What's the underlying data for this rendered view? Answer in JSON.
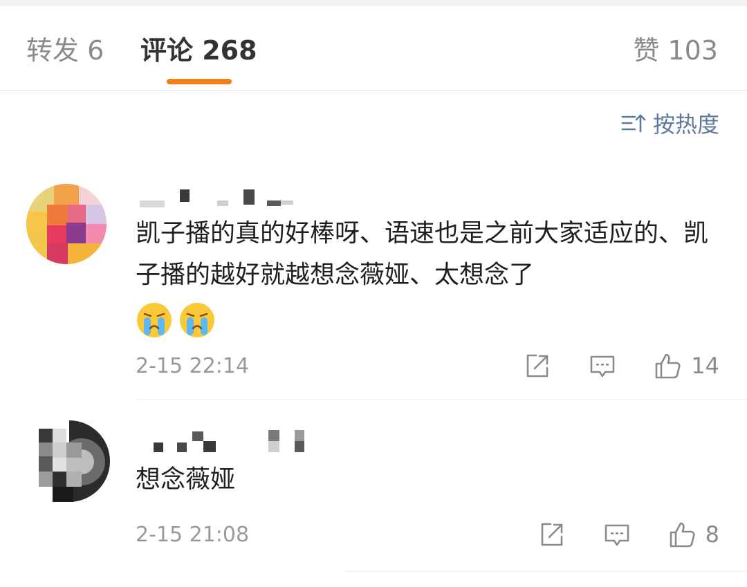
{
  "tabs": {
    "repost": "转发 6",
    "comments": "评论 268",
    "likes": "赞 103"
  },
  "sort": {
    "label": "按热度",
    "icon": "sort-desc-icon"
  },
  "comments": [
    {
      "text": "凯子播的真的好棒呀、语速也是之前大家适应的、凯子播的越好就越想念薇娅、太想念了",
      "emojis": [
        "crying-emoji",
        "crying-emoji"
      ],
      "time": "2-15 22:14",
      "likes": "14"
    },
    {
      "text": "想念薇娅",
      "time": "2-15 21:08",
      "likes": "8"
    }
  ],
  "colors": {
    "accent": "#f08318",
    "link": "#5d7a9d",
    "muted": "#999999"
  }
}
